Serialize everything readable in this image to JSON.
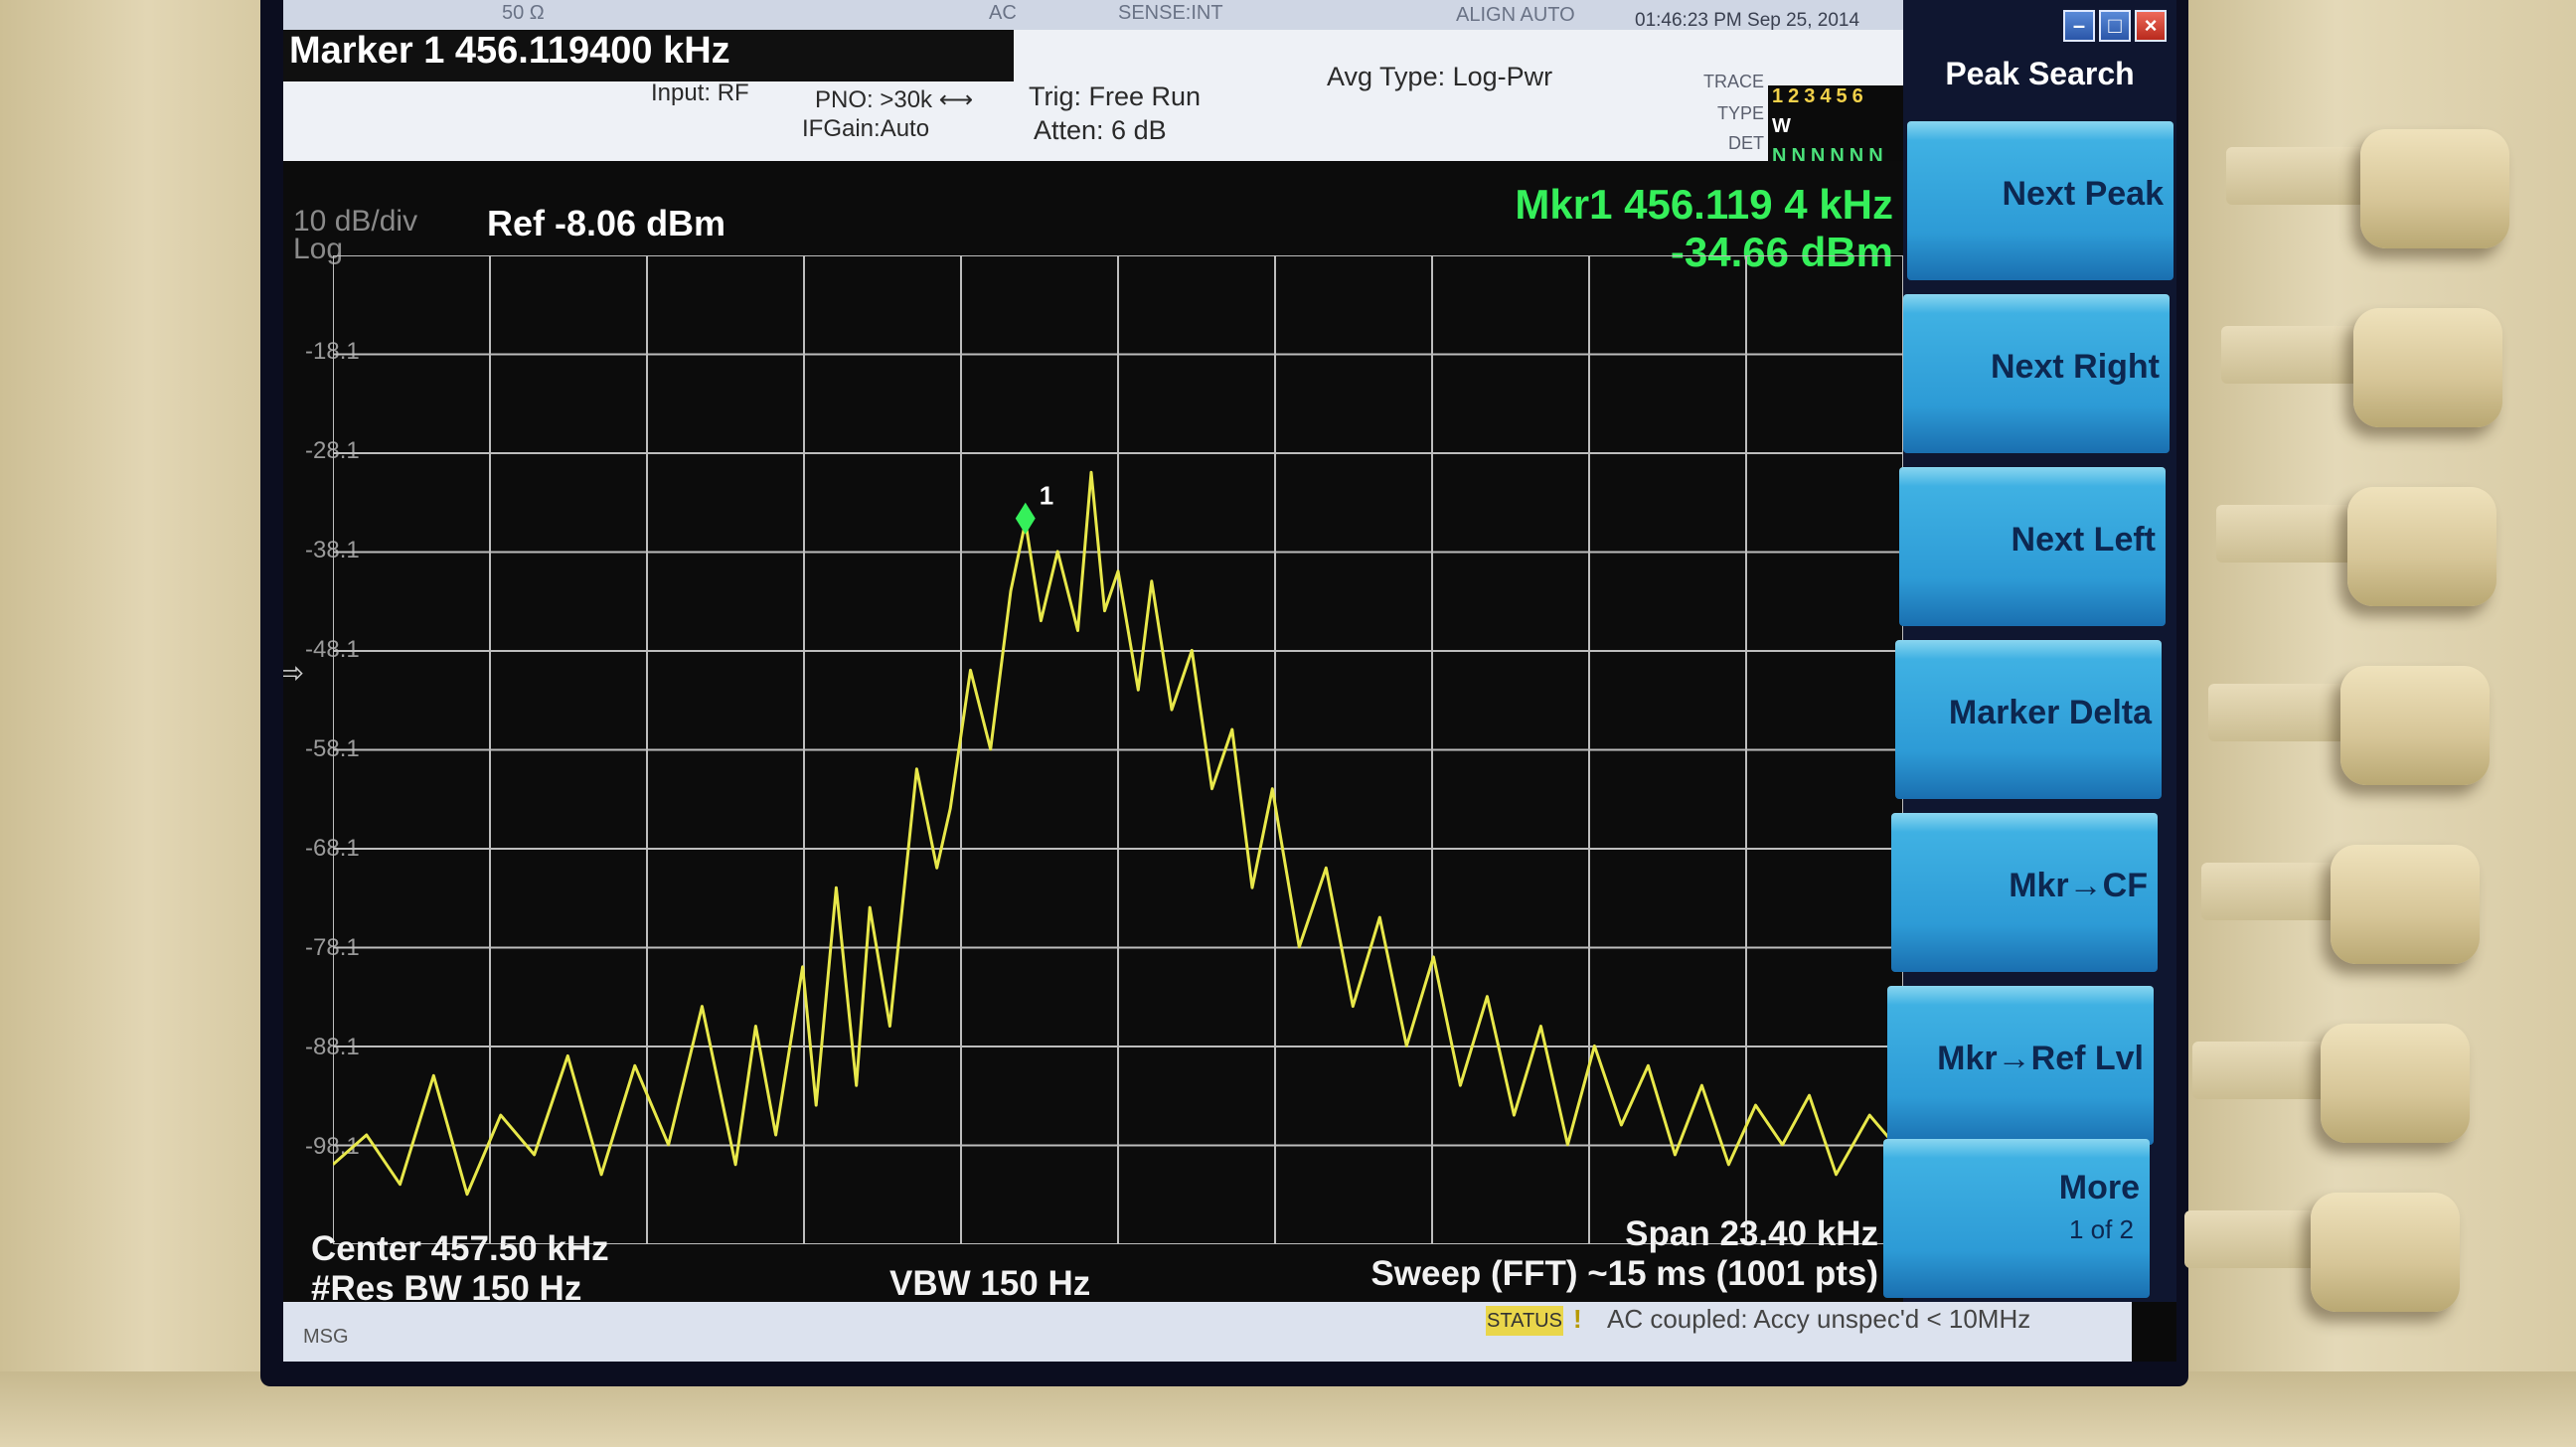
{
  "header": {
    "strip": {
      "impedance": "50 Ω",
      "coupling": "AC",
      "sense": "SENSE:INT",
      "align": "ALIGN AUTO",
      "datetime": "01:46:23 PM Sep 25, 2014"
    },
    "marker_title": "Marker 1  456.119400 kHz",
    "input": "Input: RF",
    "pno": "PNO: >30k  ⟷",
    "ifgain": "IFGain:Auto",
    "trig": "Trig: Free Run",
    "atten": "Atten: 6 dB",
    "avg_type": "Avg Type: Log-Pwr",
    "trace_label": "TRACE",
    "type_label": "TYPE",
    "det_label": "DET",
    "trace_digits": "123456",
    "type_value": "W",
    "det_value": "NNNNNN"
  },
  "display": {
    "scale": "10 dB/div",
    "scale_type": "Log",
    "ref_level": "Ref -8.06 dBm",
    "mkr_freq": "Mkr1 456.119 4 kHz",
    "mkr_amp": "-34.66 dBm",
    "marker_number": "1",
    "center": "Center 457.50 kHz",
    "res_bw": "#Res BW 150 Hz",
    "vbw": "VBW 150 Hz",
    "span": "Span 23.40 kHz",
    "sweep": "Sweep (FFT)  ~15 ms (1001 pts)"
  },
  "chart_data": {
    "type": "line",
    "yticks": [
      "-18.1",
      "-28.1",
      "-38.1",
      "-48.1",
      "-58.1",
      "-68.1",
      "-78.1",
      "-88.1",
      "-98.1"
    ],
    "ylim": [
      -108.06,
      -8.06
    ],
    "xlim_khz": [
      445.8,
      469.2
    ],
    "grid": true,
    "series": [
      {
        "color": "#e8e84a",
        "x": [
          445.8,
          446.3,
          446.8,
          447.3,
          447.8,
          448.3,
          448.8,
          449.3,
          449.8,
          450.3,
          450.8,
          451.3,
          451.8,
          452.1,
          452.4,
          452.8,
          453.0,
          453.3,
          453.6,
          453.8,
          454.1,
          454.5,
          454.8,
          455.0,
          455.3,
          455.6,
          455.9,
          456.12,
          456.35,
          456.6,
          456.9,
          457.1,
          457.3,
          457.5,
          457.8,
          458.0,
          458.3,
          458.6,
          458.9,
          459.2,
          459.5,
          459.8,
          460.2,
          460.6,
          461.0,
          461.4,
          461.8,
          462.2,
          462.6,
          463.0,
          463.4,
          463.8,
          464.2,
          464.6,
          465.0,
          465.4,
          465.8,
          466.2,
          466.6,
          467.0,
          467.4,
          467.8,
          468.2,
          468.7,
          469.2
        ],
        "y": [
          -100,
          -97,
          -102,
          -91,
          -103,
          -95,
          -99,
          -89,
          -101,
          -90,
          -98,
          -84,
          -100,
          -86,
          -97,
          -80,
          -94,
          -72,
          -92,
          -74,
          -86,
          -60,
          -70,
          -64,
          -50,
          -58,
          -42,
          -35,
          -45,
          -38,
          -46,
          -30,
          -44,
          -40,
          -52,
          -41,
          -54,
          -48,
          -62,
          -56,
          -72,
          -62,
          -78,
          -70,
          -84,
          -75,
          -88,
          -79,
          -92,
          -83,
          -95,
          -86,
          -98,
          -88,
          -96,
          -90,
          -99,
          -92,
          -100,
          -94,
          -98,
          -93,
          -101,
          -95,
          -99
        ]
      }
    ]
  },
  "status": {
    "msg": "MSG",
    "tag": "STATUS",
    "warning_icon": "warning-icon",
    "text": "AC coupled: Accy unspec'd < 10MHz"
  },
  "menu": {
    "title": "Peak Search",
    "window_controls": [
      "minimize-icon",
      "maximize-icon",
      "close-icon"
    ],
    "softkeys": [
      {
        "label": "Next Peak",
        "sub": ""
      },
      {
        "label": "Next Right",
        "sub": ""
      },
      {
        "label": "Next Left",
        "sub": ""
      },
      {
        "label": "Marker Delta",
        "sub": ""
      },
      {
        "label": "Mkr→CF",
        "sub": ""
      },
      {
        "label": "Mkr→Ref Lvl",
        "sub": ""
      },
      {
        "label": "More",
        "sub": "1 of 2"
      }
    ]
  },
  "colors": {
    "trace": "#e8e84a",
    "marker": "#35f05a",
    "softkey": "#2d9bd6"
  }
}
